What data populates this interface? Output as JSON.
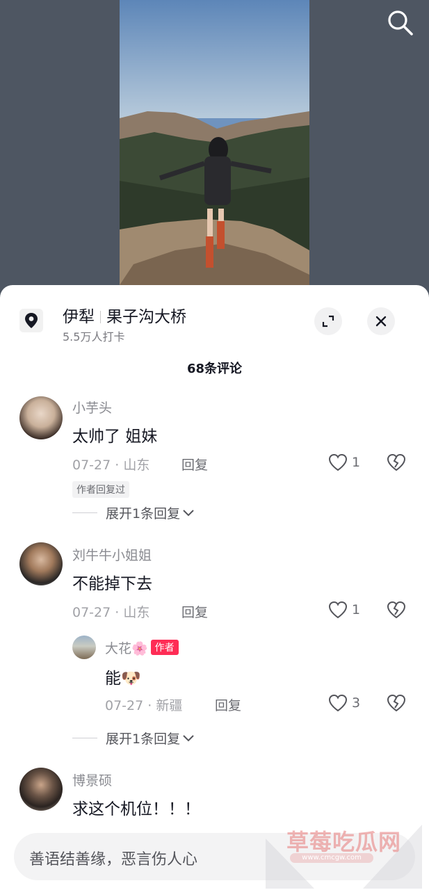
{
  "location": {
    "city": "伊犁",
    "place": "果子沟大桥",
    "checkins": "5.5万人打卡"
  },
  "comments_count": "68条评论",
  "comments": [
    {
      "user": "小芋头",
      "text": "太帅了 姐妹",
      "date": "07-27",
      "region": "山东",
      "reply_label": "回复",
      "likes": "1",
      "author_replied": "作者回复过",
      "expand": "展开1条回复"
    },
    {
      "user": "刘牛牛小姐姐",
      "text": "不能掉下去",
      "date": "07-27",
      "region": "山东",
      "reply_label": "回复",
      "likes": "1",
      "reply": {
        "user": "大花🌸",
        "badge": "作者",
        "text": "能🐶",
        "date": "07-27",
        "region": "新疆",
        "reply_label": "回复",
        "likes": "3"
      },
      "expand": "展开1条回复"
    },
    {
      "user": "博景硕",
      "text": "求这个机位！！！"
    }
  ],
  "input_placeholder": "善语结善缘，恶言伤人心",
  "watermark": {
    "text": "草莓吃瓜网",
    "url": "www.cmcgw.com"
  }
}
